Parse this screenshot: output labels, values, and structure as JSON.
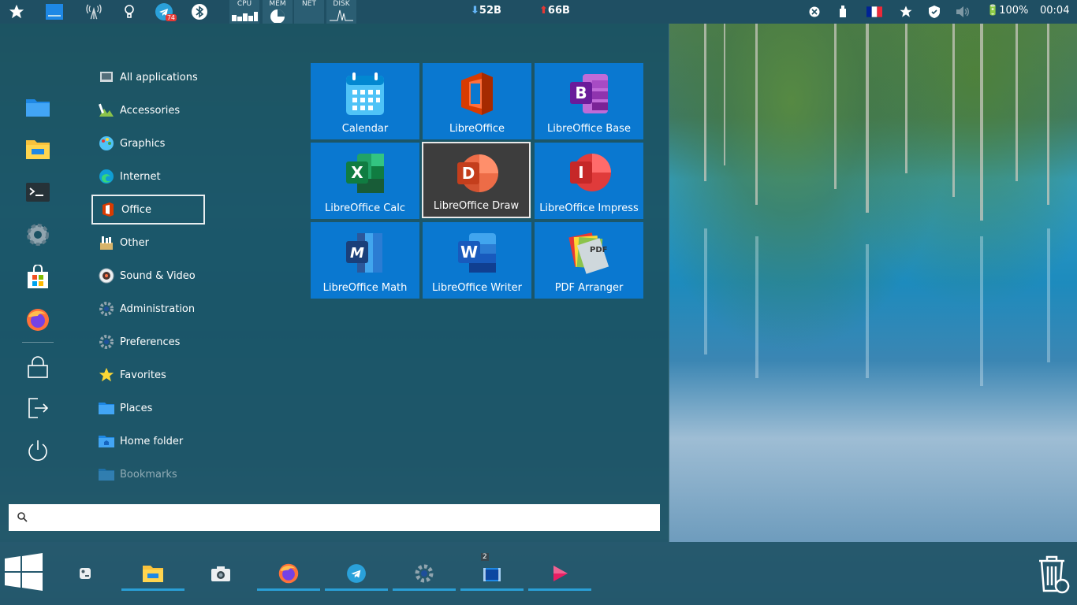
{
  "top_panel": {
    "meters": [
      "CPU",
      "MEM",
      "NET",
      "DISK"
    ],
    "telegram_badge": "74",
    "download": "52B",
    "upload": "66B",
    "battery": "100%",
    "clock": "00:04"
  },
  "categories": [
    {
      "label": "All applications",
      "icon": "all-apps-icon"
    },
    {
      "label": "Accessories",
      "icon": "accessories-icon"
    },
    {
      "label": "Graphics",
      "icon": "graphics-icon"
    },
    {
      "label": "Internet",
      "icon": "internet-icon"
    },
    {
      "label": "Office",
      "icon": "office-icon",
      "selected": true
    },
    {
      "label": "Other",
      "icon": "other-icon"
    },
    {
      "label": "Sound & Video",
      "icon": "sound-video-icon"
    },
    {
      "label": "Administration",
      "icon": "administration-icon"
    },
    {
      "label": "Preferences",
      "icon": "preferences-icon"
    },
    {
      "label": "Favorites",
      "icon": "favorites-icon"
    },
    {
      "label": "Places",
      "icon": "places-icon"
    },
    {
      "label": "Home folder",
      "icon": "home-folder-icon"
    },
    {
      "label": "Bookmarks",
      "icon": "bookmarks-icon"
    }
  ],
  "apps": [
    {
      "label": "Calendar",
      "icon": "calendar-icon"
    },
    {
      "label": "LibreOffice",
      "icon": "libreoffice-icon"
    },
    {
      "label": "LibreOffice Base",
      "icon": "libreoffice-base-icon"
    },
    {
      "label": "LibreOffice Calc",
      "icon": "libreoffice-calc-icon"
    },
    {
      "label": "LibreOffice Draw",
      "icon": "libreoffice-draw-icon",
      "active": true
    },
    {
      "label": "LibreOffice Impress",
      "icon": "libreoffice-impress-icon"
    },
    {
      "label": "LibreOffice Math",
      "icon": "libreoffice-math-icon"
    },
    {
      "label": "LibreOffice Writer",
      "icon": "libreoffice-writer-icon"
    },
    {
      "label": "PDF Arranger",
      "icon": "pdf-arranger-icon"
    }
  ],
  "search": {
    "value": "",
    "placeholder": ""
  },
  "taskbar": {
    "items": [
      "start-button",
      "settings-app",
      "file-manager",
      "screenshot-app",
      "firefox",
      "telegram",
      "system-settings",
      "video-editor",
      "media-player",
      "trash"
    ],
    "video_badge": "2"
  },
  "colors": {
    "tile": "#0a78d0",
    "tile_active": "#3d3d3d",
    "panel": "#1f4f63",
    "menu_bg": "#1b5263"
  }
}
